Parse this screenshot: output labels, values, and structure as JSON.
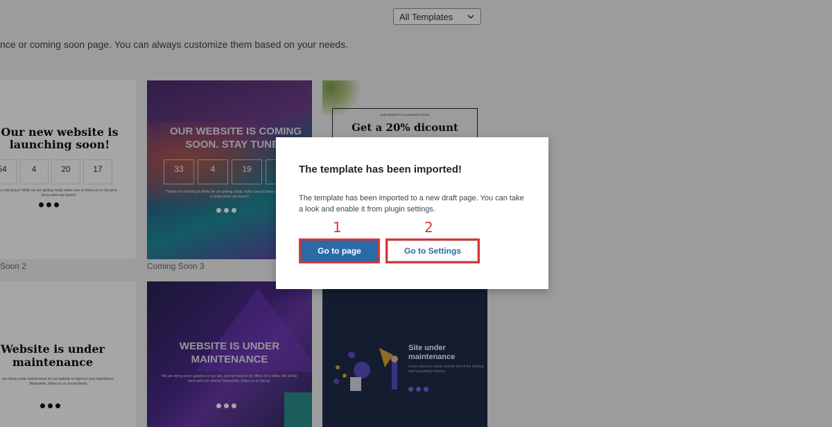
{
  "header": {
    "filter_select": {
      "value": "All Templates"
    },
    "intro_text": "nce or coming soon page. You can always customize them based on your needs."
  },
  "templates": [
    {
      "caption": "Soon 2",
      "title": "Our new website is launching soon!",
      "counters": [
        {
          "value": "54",
          "unit": ""
        },
        {
          "value": "4",
          "unit": ""
        },
        {
          "value": "20",
          "unit": ""
        },
        {
          "value": "17",
          "unit": ""
        }
      ],
      "text": "e checking it! While we are getting ready make sure to follow us on Social to know when we launch!"
    },
    {
      "caption": "Coming Soon 3",
      "title": "OUR WEBSITE IS COMING SOON. STAY TUNED",
      "counters": [
        {
          "value": "33",
          "unit": ""
        },
        {
          "value": "4",
          "unit": ""
        },
        {
          "value": "19",
          "unit": ""
        },
        {
          "value": "3",
          "unit": ""
        }
      ],
      "text": "Thanks for checking it! While we are getting ready, make sure to follow us on Social to know when we launch!"
    },
    {
      "kicker": "OUR WEBSITE IS LAUNCHING SOON",
      "title": "Get a 20% dicount"
    },
    {
      "title": "Website is under maintenance",
      "text": "are doing some maintenance on our website to improve your experience. Meanwhile, follow us on Social Media"
    },
    {
      "title": "WEBSITE IS UNDER MAINTENANCE",
      "text": "We are doing some updates on our site, and we need to be offline for a while. We will be back with you shortly! Meanwhile, follow us on Social."
    },
    {
      "title": "Site under maintenance",
      "text": "Lorem ipsum is simply dummy text of the printing and typesetting industry."
    }
  ],
  "modal": {
    "title": "The template has been imported!",
    "message": "The template has been imported to a new draft page. You can take a look and enable it from plugin settings.",
    "primary_button": "Go to page",
    "secondary_button": "Go to Settings",
    "markers": [
      "1",
      "2"
    ],
    "highlight_color": "#d63638",
    "primary_color": "#2b6aa6"
  }
}
